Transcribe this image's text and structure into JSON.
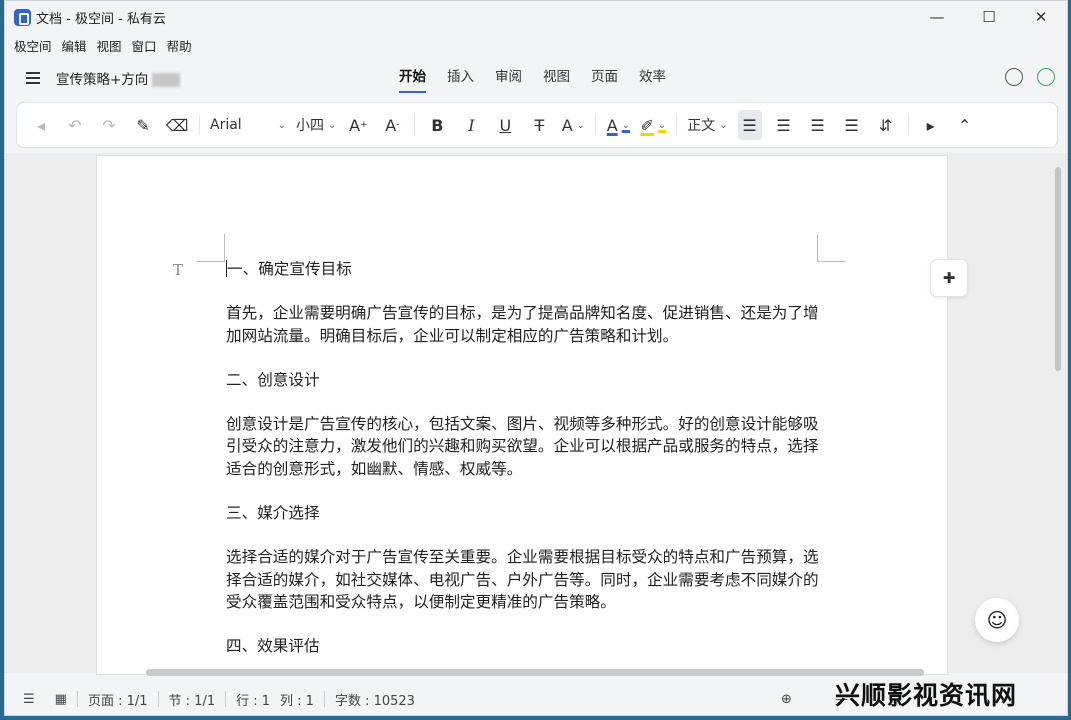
{
  "window": {
    "title": "文档 - 极空间 - 私有云",
    "controls": [
      "—",
      "☐",
      "✕"
    ]
  },
  "menu": [
    "极空间",
    "编辑",
    "视图",
    "窗口",
    "帮助"
  ],
  "doc": {
    "name": "宣传策略+方向",
    "tabs": [
      {
        "label": "开始",
        "active": true
      },
      {
        "label": "插入",
        "active": false
      },
      {
        "label": "审阅",
        "active": false
      },
      {
        "label": "视图",
        "active": false
      },
      {
        "label": "页面",
        "active": false
      },
      {
        "label": "效率",
        "active": false
      }
    ]
  },
  "toolbar": {
    "font": "Arial",
    "size": "小四",
    "style": "正文"
  },
  "content": {
    "h1": "一、确定宣传目标",
    "p1": "首先，企业需要明确广告宣传的目标，是为了提高品牌知名度、促进销售、还是为了增加网站流量。明确目标后，企业可以制定相应的广告策略和计划。",
    "h2": "二、创意设计",
    "p2": "创意设计是广告宣传的核心，包括文案、图片、视频等多种形式。好的创意设计能够吸引受众的注意力，激发他们的兴趣和购买欲望。企业可以根据产品或服务的特点，选择适合的创意形式，如幽默、情感、权威等。",
    "h3": "三、媒介选择",
    "p3": "选择合适的媒介对于广告宣传至关重要。企业需要根据目标受众的特点和广告预算，选择合适的媒介，如社交媒体、电视广告、户外广告等。同时，企业需要考虑不同媒介的受众覆盖范围和受众特点，以便制定更精准的广告策略。",
    "h4": "四、效果评估"
  },
  "status": {
    "page": "页面 : 1/1",
    "section": "节 : 1/1",
    "row": "行 : 1",
    "col": "列 : 1",
    "words": "字数 : 10523"
  },
  "watermark": "兴顺影视资讯网"
}
